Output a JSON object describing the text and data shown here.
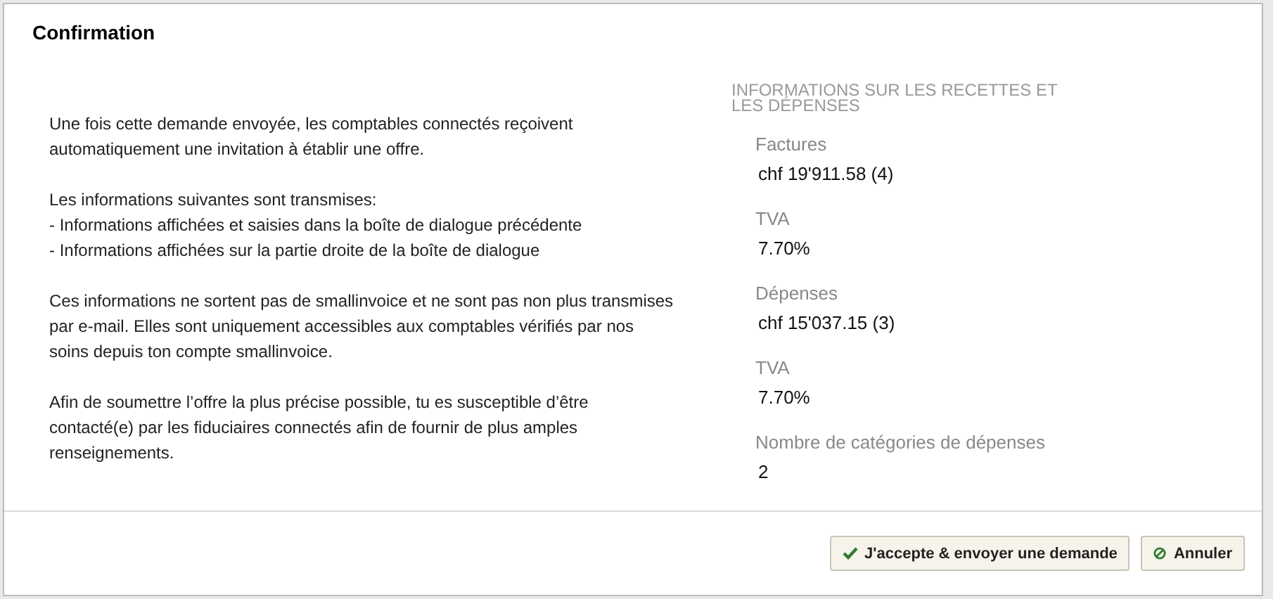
{
  "dialog": {
    "title": "Confirmation",
    "paragraphs": [
      [
        "Une fois cette demande envoyée, les comptables connectés reçoivent",
        "automatiquement une invitation à établir une offre."
      ],
      [
        "Les informations suivantes sont transmises:",
        "- Informations affichées et saisies dans la boîte de dialogue précédente",
        "- Informations affichées sur la partie droite de la boîte de dialogue"
      ],
      [
        "Ces informations ne sortent pas de smallinvoice et ne sont pas non plus transmises",
        "par e-mail. Elles sont uniquement accessibles aux comptables vérifiés par nos",
        "soins depuis ton compte smallinvoice."
      ],
      [
        "Afin de soumettre l’offre la plus précise possible, tu es susceptible d’être",
        "contacté(e) par les fiduciaires connectés afin de fournir de plus amples",
        "renseignements."
      ]
    ],
    "summary": {
      "heading": [
        "INFORMATIONS SUR LES RECETTES ET",
        "LES DÉPENSES"
      ],
      "fields": [
        {
          "label": "Factures",
          "value": "chf 19'911.58 (4)"
        },
        {
          "label": "TVA",
          "value": "7.70%"
        },
        {
          "label": "Dépenses",
          "value": "chf 15'037.15 (3)"
        },
        {
          "label": "TVA",
          "value": "7.70%"
        },
        {
          "label": "Nombre de catégories de dépenses",
          "value": "2"
        }
      ]
    },
    "buttons": [
      {
        "label": "J'accepte & envoyer une demande",
        "kind": "confirm"
      },
      {
        "label": "Annuler",
        "kind": "cancel"
      }
    ]
  }
}
